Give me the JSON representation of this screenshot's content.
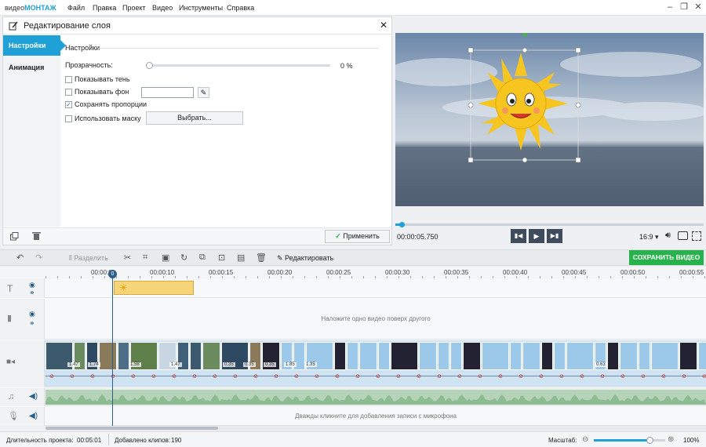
{
  "app": {
    "logo_prefix": "видео",
    "logo_suffix": "МОНТАЖ"
  },
  "menu": [
    "Файл",
    "Правка",
    "Проект",
    "Видео",
    "Инструменты",
    "Справка"
  ],
  "panel": {
    "title": "Редактирование слоя",
    "tabs": [
      "Настройки",
      "Анимация"
    ],
    "section": "Настройки",
    "opacity_label": "Прозрачность:",
    "opacity_value": "0 %",
    "opacity_level": 0,
    "show_shadow": "Показывать тень",
    "show_bg": "Показывать фон",
    "keep_proportions": "Сохранять пропорции",
    "use_mask": "Использовать маску",
    "choose": "Выбрать...",
    "apply": "Применить"
  },
  "player": {
    "time": "00:00:05.750",
    "aspect": "16:9",
    "progress": 0.02
  },
  "toolbar": {
    "split": "Разделить",
    "edit": "Редактировать",
    "save": "СОХРАНИТЬ ВИДЕО"
  },
  "ruler": [
    "00:00:0",
    "00:00:10",
    "00:00:15",
    "00:00:20",
    "00:00:25",
    "00:00:30",
    "00:00:35",
    "00:00:40",
    "00:00:45",
    "00:00:50",
    "00:00:55"
  ],
  "timeline": {
    "playhead": "0",
    "overlay_hint": "Наложите одно видео поверх другого",
    "mic_hint": "Дважды кликните для добавления записи с микрофона",
    "clip_labels": [
      "1.47",
      "1.74",
      "1.58",
      "1.47",
      "0.35",
      "0.35",
      "0.35",
      "1.85",
      "1.35",
      "0.63"
    ]
  },
  "status": {
    "duration_label": "Длительность проекта:",
    "duration": "00:05:01",
    "clips_label": "Добавлено клипов:",
    "clips": "190",
    "scale_label": "Масштаб:",
    "zoom": "100%",
    "zoom_level": 0.78
  },
  "colors": {
    "accent": "#1fa0d6",
    "save": "#27b34b",
    "sun": "#f7c520"
  }
}
